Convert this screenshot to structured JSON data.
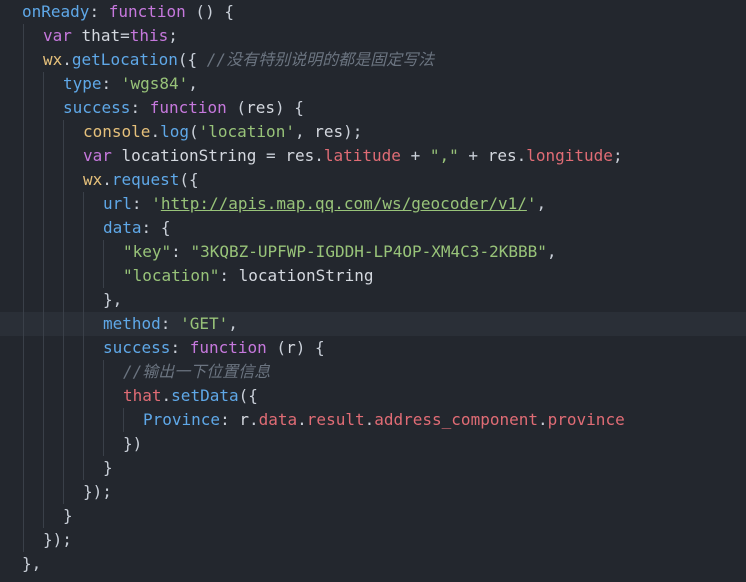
{
  "editor": {
    "lines": [
      "onReady: function () {",
      "var that=this;",
      "wx.getLocation({ //没有特别说明的都是固定写法",
      "type: 'wgs84',",
      "success: function (res) {",
      "console.log('location', res);",
      "var locationString = res.latitude + \",\" + res.longitude;",
      "wx.request({",
      "url: 'http://apis.map.qq.com/ws/geocoder/v1/',",
      "data: {",
      "\"key\": \"3KQBZ-UPFWP-IGDDH-LP4OP-XM4C3-2KBBB\",",
      "\"location\": locationString",
      "},",
      "method: 'GET',",
      "success: function (r) {",
      "//输出一下位置信息",
      "that.setData({",
      "Province: r.data.result.address_component.province",
      "})",
      "}",
      "});",
      "}",
      "});",
      "},"
    ]
  },
  "colors": {
    "background": "#23272e",
    "active_line": "#2a2f37",
    "property": "#5fa8e8",
    "keyword": "#c678dd",
    "string": "#98c379",
    "comment": "#6b7480",
    "this_keyword": "#e06c75"
  }
}
